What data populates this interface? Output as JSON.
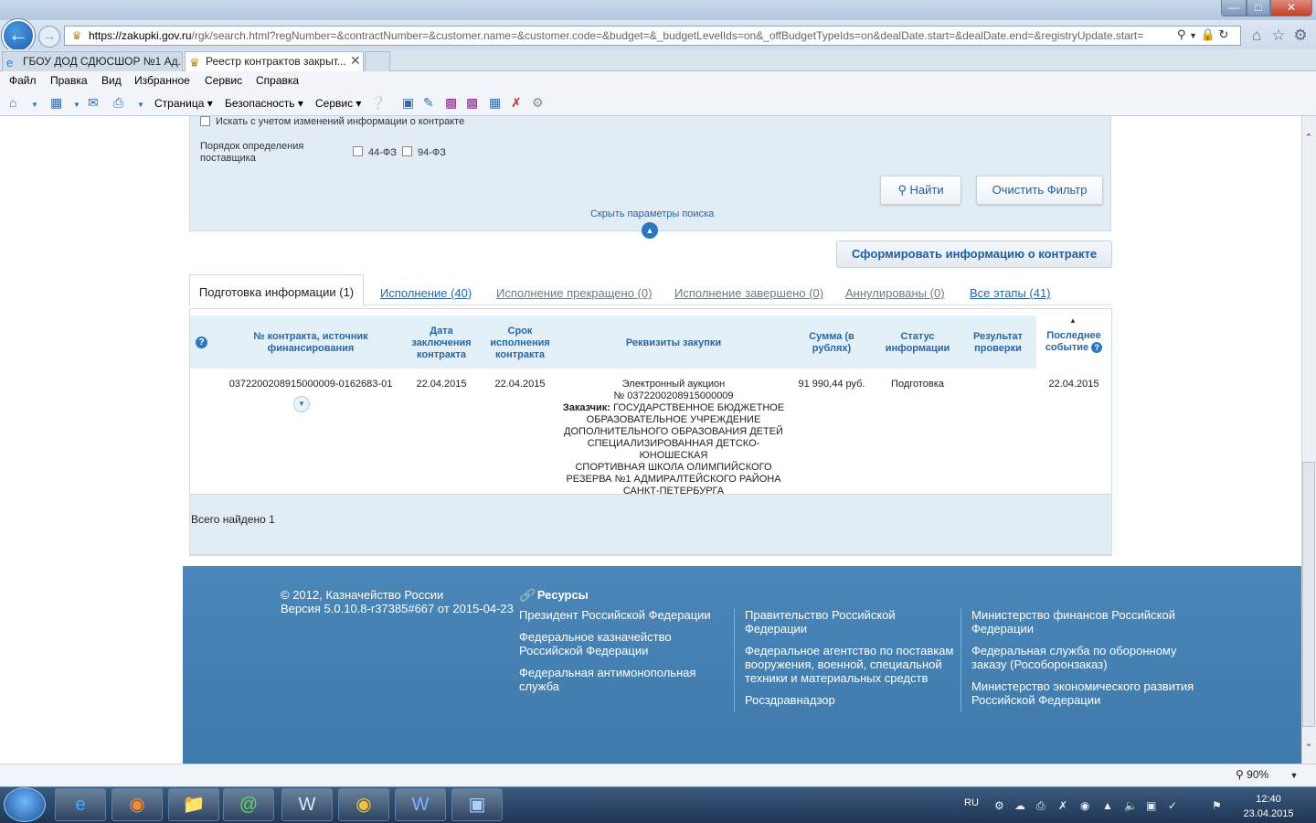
{
  "browser": {
    "url_host": "https://zakupki.gov.ru",
    "url_rest": "/rgk/search.html?regNumber=&contractNumber=&customer.name=&customer.code=&budget=&_budgetLevelIds=on&_offBudgetTypeIds=on&dealDate.start=&dealDate.end=&registryUpdate.start=",
    "tabs": [
      {
        "label": "ГБОУ ДОД СДЮСШОР №1 Ад..."
      },
      {
        "label": "Реестр контрактов закрыт..."
      }
    ],
    "menu": [
      "Файл",
      "Правка",
      "Вид",
      "Избранное",
      "Сервис",
      "Справка"
    ],
    "commands": {
      "page": "Страница",
      "security": "Безопасность",
      "service": "Сервис"
    },
    "zoom": "90%"
  },
  "search": {
    "changes_checkbox_label": "Искать с учетом изменений информации о контракте",
    "supplier_order_label_1": "Порядок определения",
    "supplier_order_label_2": "поставщика",
    "option_44": "44-ФЗ",
    "option_94": "94-ФЗ",
    "find_button": "Найти",
    "clear_button": "Очистить Фильтр",
    "hide_params": "Скрыть параметры поиска"
  },
  "form_contract_button": "Сформировать информацию о контракте",
  "stages": [
    {
      "label": "Подготовка информации (1)"
    },
    {
      "label": "Исполнение (40)"
    },
    {
      "label": "Исполнение прекращено (0)"
    },
    {
      "label": "Исполнение завершено (0)"
    },
    {
      "label": "Аннулированы (0)"
    },
    {
      "label": "Все этапы (41)"
    }
  ],
  "table": {
    "headers": {
      "contract_1": "№ контракта, источник",
      "contract_2": "финансирования",
      "date_1": "Дата",
      "date_2": "заключения",
      "date_3": "контракта",
      "term_1": "Срок",
      "term_2": "исполнения",
      "term_3": "контракта",
      "requisites": "Реквизиты закупки",
      "sum_1": "Сумма (в",
      "sum_2": "рублях)",
      "status_1": "Статус",
      "status_2": "информации",
      "result_1": "Результат",
      "result_2": "проверки",
      "last_1": "Последнее",
      "last_2": "событие"
    },
    "rows": [
      {
        "contract_number": "0372200208915000009-0162683-01",
        "conclusion_date": "22.04.2015",
        "execution_term": "22.04.2015",
        "procurement_type": "Электронный аукцион",
        "procurement_number": "№ 0372200208915000009",
        "customer_label": "Заказчик:",
        "customer_lines": [
          "ГОСУДАРСТВЕННОЕ БЮДЖЕТНОЕ",
          "ОБРАЗОВАТЕЛЬНОЕ УЧРЕЖДЕНИЕ",
          "ДОПОЛНИТЕЛЬНОГО ОБРАЗОВАНИЯ ДЕТЕЙ",
          "СПЕЦИАЛИЗИРОВАННАЯ ДЕТСКО-ЮНОШЕСКАЯ",
          "СПОРТИВНАЯ ШКОЛА ОЛИМПИЙСКОГО",
          "РЕЗЕРВА №1 АДМИРАЛТЕЙСКОГО РАЙОНА",
          "САНКТ-ПЕТЕРБУРГА"
        ],
        "sum": "91 990,44 руб.",
        "status": "Подготовка",
        "check_result": "",
        "last_event": "22.04.2015"
      }
    ]
  },
  "total_found": "Всего найдено 1",
  "footer": {
    "copyright": "© 2012, Казначейство России",
    "version": "Версия 5.0.10.8-r37385#667 от 2015-04-23",
    "resources_title": "Ресурсы",
    "col1": [
      [
        "Президент Российской Федерации"
      ],
      [
        "Федеральное казначейство",
        "Российской Федерации"
      ],
      [
        "Федеральная антимонопольная",
        "служба"
      ]
    ],
    "col2": [
      [
        "Правительство Российской",
        "Федерации"
      ],
      [
        "Федеральное агентство по поставкам",
        "вооружения, военной, специальной",
        "техники и материальных средств"
      ],
      [
        "Росздравнадзор"
      ]
    ],
    "col3": [
      [
        "Министерство финансов Российской",
        "Федерации"
      ],
      [
        "Федеральная служба по оборонному",
        "заказу (Рособоронзаказ)"
      ],
      [
        "Министерство экономического развития",
        "Российской Федерации"
      ]
    ]
  },
  "taskbar": {
    "lang": "RU",
    "time": "12:40",
    "date": "23.04.2015"
  },
  "icons": [
    "back-arrow-icon",
    "forward-arrow-icon",
    "search-icon",
    "lock-icon",
    "refresh-icon",
    "home-icon",
    "star-icon",
    "gear-icon",
    "help-icon",
    "expand-icon",
    "link-icon",
    "windows-start-icon"
  ]
}
